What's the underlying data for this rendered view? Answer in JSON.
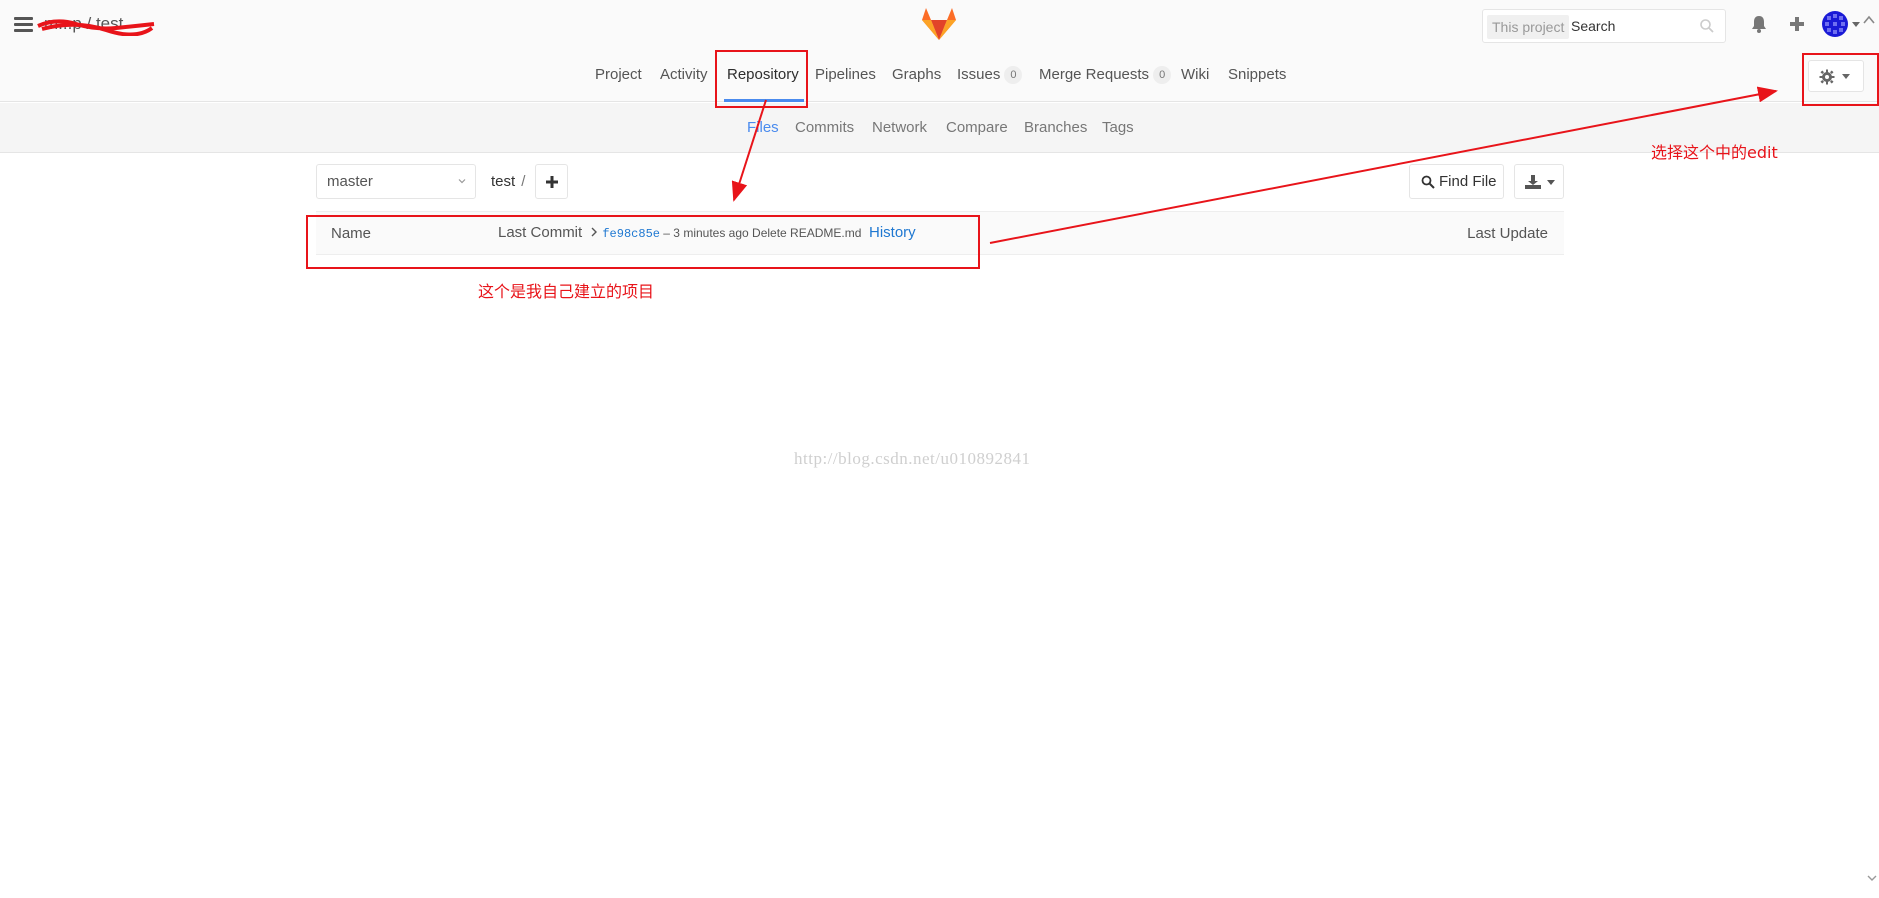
{
  "header": {
    "project_path": "m...p / test",
    "search_scope": "This project",
    "search_placeholder": "Search"
  },
  "nav": {
    "main": [
      {
        "label": "Project"
      },
      {
        "label": "Activity"
      },
      {
        "label": "Repository"
      },
      {
        "label": "Pipelines"
      },
      {
        "label": "Graphs"
      },
      {
        "label": "Issues",
        "badge": "0"
      },
      {
        "label": "Merge Requests",
        "badge": "0"
      },
      {
        "label": "Wiki"
      },
      {
        "label": "Snippets"
      }
    ],
    "active": "Repository",
    "sub": [
      {
        "label": "Files"
      },
      {
        "label": "Commits"
      },
      {
        "label": "Network"
      },
      {
        "label": "Compare"
      },
      {
        "label": "Branches"
      },
      {
        "label": "Tags"
      }
    ],
    "sub_active": "Files"
  },
  "toolbar": {
    "branch": "master",
    "path_root": "test",
    "path_sep": "/",
    "find_file_label": "Find File"
  },
  "tree": {
    "col_name": "Name",
    "col_last_commit": "Last Commit",
    "commit_sha": "fe98c85e",
    "commit_meta": " – 3 minutes ago Delete README.md",
    "history_label": "History",
    "col_last_update": "Last Update"
  },
  "watermark": "http://blog.csdn.net/u010892841",
  "annotations": {
    "project_note": "这个是我自己建立的项目",
    "settings_note": "选择这个中的edit",
    "color": "#e8141a"
  },
  "colors": {
    "accent": "#4a8bee",
    "link": "#1f78d1",
    "gitlab_orange": "#fc6d26"
  }
}
